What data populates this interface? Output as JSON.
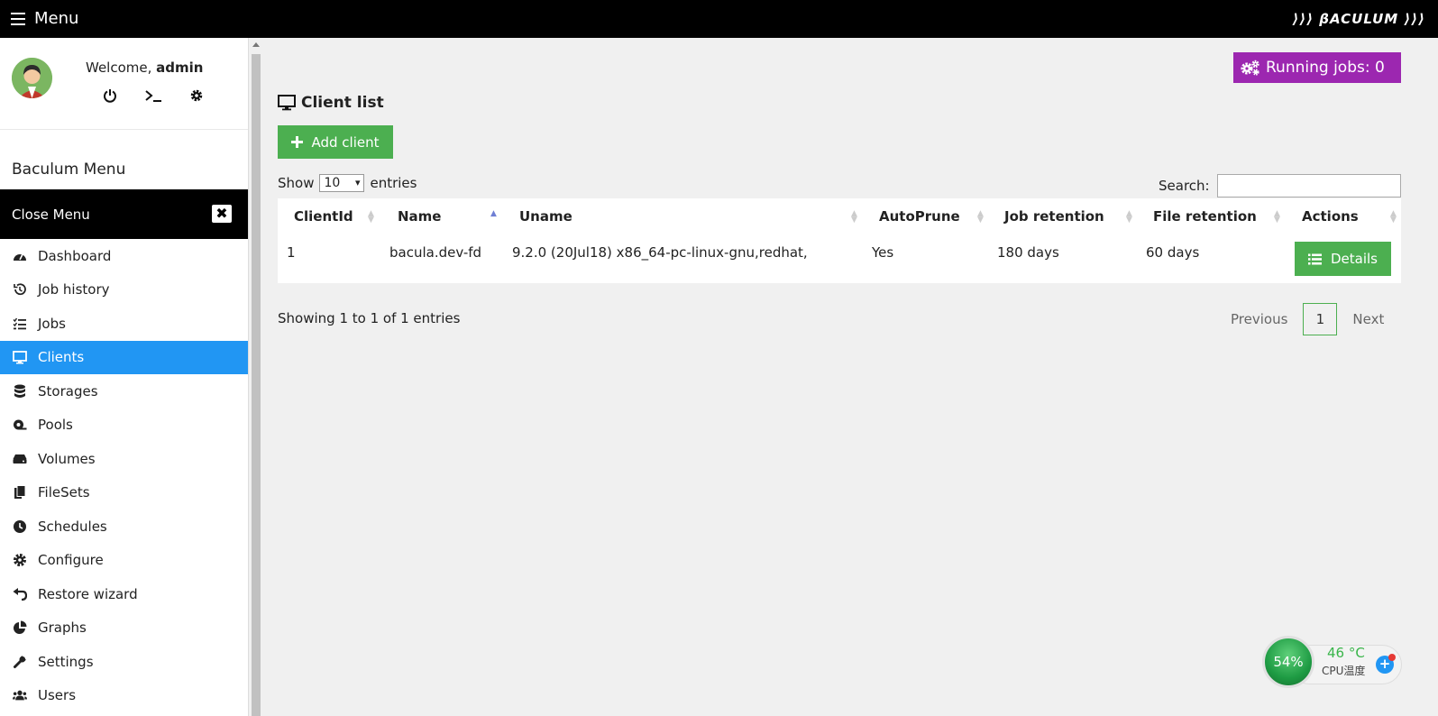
{
  "topbar": {
    "menu_label": "Menu",
    "logo": "⟩⟩⟩ βACULUM ⟩⟩⟩"
  },
  "user": {
    "welcome": "Welcome,",
    "username": "admin"
  },
  "sidebar": {
    "title": "Baculum Menu",
    "close_label": "Close Menu",
    "items": [
      {
        "label": "Dashboard",
        "icon": "dashboard-icon"
      },
      {
        "label": "Job history",
        "icon": "history-icon"
      },
      {
        "label": "Jobs",
        "icon": "tasks-icon"
      },
      {
        "label": "Clients",
        "icon": "desktop-icon",
        "active": true
      },
      {
        "label": "Storages",
        "icon": "database-icon"
      },
      {
        "label": "Pools",
        "icon": "tape-icon"
      },
      {
        "label": "Volumes",
        "icon": "hdd-icon"
      },
      {
        "label": "FileSets",
        "icon": "copy-icon"
      },
      {
        "label": "Schedules",
        "icon": "clock-icon"
      },
      {
        "label": "Configure",
        "icon": "gear-icon"
      },
      {
        "label": "Restore wizard",
        "icon": "undo-icon"
      },
      {
        "label": "Graphs",
        "icon": "pie-chart-icon"
      },
      {
        "label": "Settings",
        "icon": "wrench-icon"
      },
      {
        "label": "Users",
        "icon": "users-icon"
      }
    ]
  },
  "running_jobs": "Running jobs: 0",
  "page": {
    "title": "Client list",
    "add_label": "Add client",
    "show_label": "Show",
    "entries_label": "entries",
    "page_size": "10",
    "search_label": "Search:"
  },
  "table": {
    "headers": [
      "ClientId",
      "Name",
      "Uname",
      "AutoPrune",
      "Job retention",
      "File retention",
      "Actions"
    ],
    "rows": [
      {
        "clientid": "1",
        "name": "bacula.dev-fd",
        "uname": "9.2.0 (20Jul18) x86_64-pc-linux-gnu,redhat,",
        "autoprune": "Yes",
        "job_retention": "180 days",
        "file_retention": "60 days",
        "action": "Details"
      }
    ]
  },
  "footer": {
    "showing": "Showing 1 to 1 of 1 entries",
    "previous": "Previous",
    "current_page": "1",
    "next": "Next"
  },
  "cpu_widget": {
    "percent": "54%",
    "temp": "46 °C",
    "label": "CPU温度"
  },
  "colors": {
    "accent": "#2196f3",
    "green": "#4caf50",
    "purple": "#9c27b0"
  }
}
